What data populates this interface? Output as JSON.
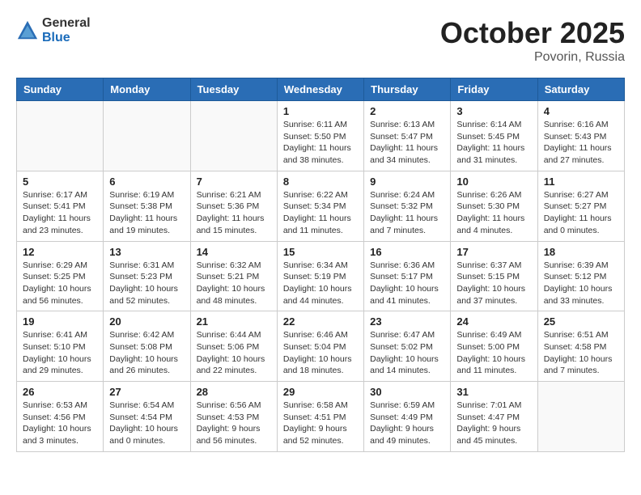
{
  "header": {
    "logo_general": "General",
    "logo_blue": "Blue",
    "title": "October 2025",
    "location": "Povorin, Russia"
  },
  "weekdays": [
    "Sunday",
    "Monday",
    "Tuesday",
    "Wednesday",
    "Thursday",
    "Friday",
    "Saturday"
  ],
  "weeks": [
    [
      {
        "day": "",
        "info": ""
      },
      {
        "day": "",
        "info": ""
      },
      {
        "day": "",
        "info": ""
      },
      {
        "day": "1",
        "info": "Sunrise: 6:11 AM\nSunset: 5:50 PM\nDaylight: 11 hours\nand 38 minutes."
      },
      {
        "day": "2",
        "info": "Sunrise: 6:13 AM\nSunset: 5:47 PM\nDaylight: 11 hours\nand 34 minutes."
      },
      {
        "day": "3",
        "info": "Sunrise: 6:14 AM\nSunset: 5:45 PM\nDaylight: 11 hours\nand 31 minutes."
      },
      {
        "day": "4",
        "info": "Sunrise: 6:16 AM\nSunset: 5:43 PM\nDaylight: 11 hours\nand 27 minutes."
      }
    ],
    [
      {
        "day": "5",
        "info": "Sunrise: 6:17 AM\nSunset: 5:41 PM\nDaylight: 11 hours\nand 23 minutes."
      },
      {
        "day": "6",
        "info": "Sunrise: 6:19 AM\nSunset: 5:38 PM\nDaylight: 11 hours\nand 19 minutes."
      },
      {
        "day": "7",
        "info": "Sunrise: 6:21 AM\nSunset: 5:36 PM\nDaylight: 11 hours\nand 15 minutes."
      },
      {
        "day": "8",
        "info": "Sunrise: 6:22 AM\nSunset: 5:34 PM\nDaylight: 11 hours\nand 11 minutes."
      },
      {
        "day": "9",
        "info": "Sunrise: 6:24 AM\nSunset: 5:32 PM\nDaylight: 11 hours\nand 7 minutes."
      },
      {
        "day": "10",
        "info": "Sunrise: 6:26 AM\nSunset: 5:30 PM\nDaylight: 11 hours\nand 4 minutes."
      },
      {
        "day": "11",
        "info": "Sunrise: 6:27 AM\nSunset: 5:27 PM\nDaylight: 11 hours\nand 0 minutes."
      }
    ],
    [
      {
        "day": "12",
        "info": "Sunrise: 6:29 AM\nSunset: 5:25 PM\nDaylight: 10 hours\nand 56 minutes."
      },
      {
        "day": "13",
        "info": "Sunrise: 6:31 AM\nSunset: 5:23 PM\nDaylight: 10 hours\nand 52 minutes."
      },
      {
        "day": "14",
        "info": "Sunrise: 6:32 AM\nSunset: 5:21 PM\nDaylight: 10 hours\nand 48 minutes."
      },
      {
        "day": "15",
        "info": "Sunrise: 6:34 AM\nSunset: 5:19 PM\nDaylight: 10 hours\nand 44 minutes."
      },
      {
        "day": "16",
        "info": "Sunrise: 6:36 AM\nSunset: 5:17 PM\nDaylight: 10 hours\nand 41 minutes."
      },
      {
        "day": "17",
        "info": "Sunrise: 6:37 AM\nSunset: 5:15 PM\nDaylight: 10 hours\nand 37 minutes."
      },
      {
        "day": "18",
        "info": "Sunrise: 6:39 AM\nSunset: 5:12 PM\nDaylight: 10 hours\nand 33 minutes."
      }
    ],
    [
      {
        "day": "19",
        "info": "Sunrise: 6:41 AM\nSunset: 5:10 PM\nDaylight: 10 hours\nand 29 minutes."
      },
      {
        "day": "20",
        "info": "Sunrise: 6:42 AM\nSunset: 5:08 PM\nDaylight: 10 hours\nand 26 minutes."
      },
      {
        "day": "21",
        "info": "Sunrise: 6:44 AM\nSunset: 5:06 PM\nDaylight: 10 hours\nand 22 minutes."
      },
      {
        "day": "22",
        "info": "Sunrise: 6:46 AM\nSunset: 5:04 PM\nDaylight: 10 hours\nand 18 minutes."
      },
      {
        "day": "23",
        "info": "Sunrise: 6:47 AM\nSunset: 5:02 PM\nDaylight: 10 hours\nand 14 minutes."
      },
      {
        "day": "24",
        "info": "Sunrise: 6:49 AM\nSunset: 5:00 PM\nDaylight: 10 hours\nand 11 minutes."
      },
      {
        "day": "25",
        "info": "Sunrise: 6:51 AM\nSunset: 4:58 PM\nDaylight: 10 hours\nand 7 minutes."
      }
    ],
    [
      {
        "day": "26",
        "info": "Sunrise: 6:53 AM\nSunset: 4:56 PM\nDaylight: 10 hours\nand 3 minutes."
      },
      {
        "day": "27",
        "info": "Sunrise: 6:54 AM\nSunset: 4:54 PM\nDaylight: 10 hours\nand 0 minutes."
      },
      {
        "day": "28",
        "info": "Sunrise: 6:56 AM\nSunset: 4:53 PM\nDaylight: 9 hours\nand 56 minutes."
      },
      {
        "day": "29",
        "info": "Sunrise: 6:58 AM\nSunset: 4:51 PM\nDaylight: 9 hours\nand 52 minutes."
      },
      {
        "day": "30",
        "info": "Sunrise: 6:59 AM\nSunset: 4:49 PM\nDaylight: 9 hours\nand 49 minutes."
      },
      {
        "day": "31",
        "info": "Sunrise: 7:01 AM\nSunset: 4:47 PM\nDaylight: 9 hours\nand 45 minutes."
      },
      {
        "day": "",
        "info": ""
      }
    ]
  ]
}
